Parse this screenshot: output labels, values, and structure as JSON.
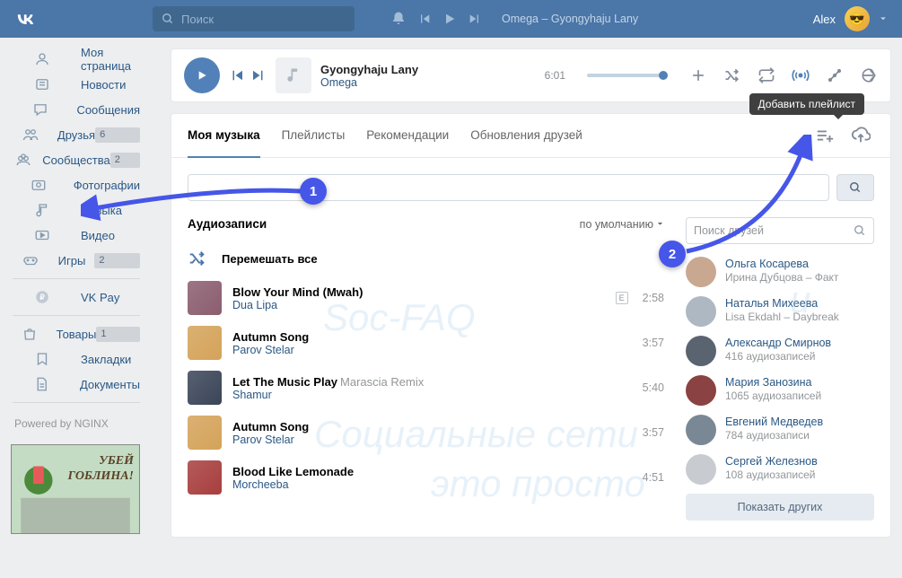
{
  "header": {
    "search_placeholder": "Поиск",
    "now_playing": "Omega – Gyongyhaju Lany",
    "username": "Alex"
  },
  "sidebar": {
    "items": [
      {
        "label": "Моя страница",
        "icon": "home"
      },
      {
        "label": "Новости",
        "icon": "news"
      },
      {
        "label": "Сообщения",
        "icon": "messages"
      },
      {
        "label": "Друзья",
        "icon": "friends",
        "badge": "6"
      },
      {
        "label": "Сообщества",
        "icon": "groups",
        "badge": "2"
      },
      {
        "label": "Фотографии",
        "icon": "photos"
      },
      {
        "label": "Музыка",
        "icon": "music"
      },
      {
        "label": "Видео",
        "icon": "video"
      },
      {
        "label": "Игры",
        "icon": "games",
        "badge": "2"
      }
    ],
    "pay_label": "VK Pay",
    "extra": [
      {
        "label": "Товары",
        "badge": "1"
      },
      {
        "label": "Закладки"
      },
      {
        "label": "Документы"
      }
    ],
    "footer": "Powered by NGINX",
    "banner": {
      "line1": "УБЕЙ",
      "line2": "ГОБЛИНА!"
    }
  },
  "player": {
    "title": "Gyongyhaju Lany",
    "artist": "Omega",
    "duration": "6:01"
  },
  "tabs": [
    "Моя музыка",
    "Плейлисты",
    "Рекомендации",
    "Обновления друзей"
  ],
  "tooltip": "Добавить плейлист",
  "audio_section": {
    "heading": "Аудиозаписи",
    "sort": "по умолчанию",
    "shuffle": "Перемешать все"
  },
  "tracks": [
    {
      "title": "Blow Your Mind (Mwah)",
      "artist": "Dua Lipa",
      "dur": "2:58",
      "explicit": true,
      "cover": "#8b5d6f"
    },
    {
      "title": "Autumn Song",
      "artist": "Parov Stelar",
      "dur": "3:57",
      "cover": "#d4a35a"
    },
    {
      "title": "Let The Music Play",
      "subtitle": "Marascia Remix",
      "artist": "Shamur",
      "dur": "5:40",
      "cover": "#3a4558"
    },
    {
      "title": "Autumn Song",
      "artist": "Parov Stelar",
      "dur": "3:57",
      "cover": "#d4a35a"
    },
    {
      "title": "Blood Like Lemonade",
      "artist": "Morcheeba",
      "dur": "4:51",
      "cover": "#a83e3e"
    }
  ],
  "friends": {
    "search_placeholder": "Поиск друзей",
    "list": [
      {
        "name": "Ольга Косарева",
        "sub": "Ирина Дубцова – Факт",
        "av": "#c9a892"
      },
      {
        "name": "Наталья Михеева",
        "sub": "Lisa Ekdahl – Daybreak",
        "av": "#aeb8c2"
      },
      {
        "name": "Александр Смирнов",
        "sub": "416 аудиозаписей",
        "av": "#5a6470"
      },
      {
        "name": "Мария Занозина",
        "sub": "1065 аудиозаписей",
        "av": "#8b4242"
      },
      {
        "name": "Евгений Медведев",
        "sub": "784 аудиозаписи",
        "av": "#7a8896"
      },
      {
        "name": "Сергей Железнов",
        "sub": "108 аудиозаписей",
        "av": "#c8ccd1"
      }
    ],
    "show_more": "Показать других"
  },
  "watermarks": {
    "w1": "Soc-FAQ",
    "w2": "Социальные сети",
    "w3": "это просто",
    "w4": "u"
  }
}
